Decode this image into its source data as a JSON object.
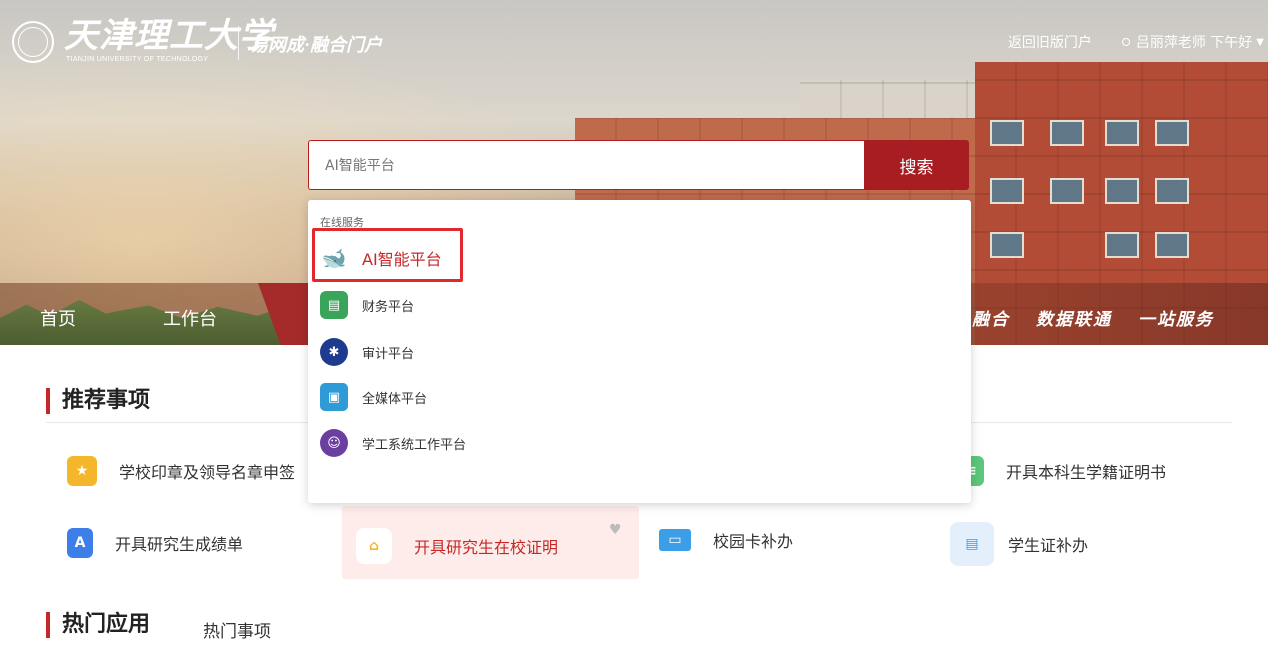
{
  "header": {
    "logo_cn": "天津理工大学",
    "logo_en": "TIANJIN UNIVERSITY OF TECHNOLOGY",
    "portal_title": "易网成·融合门户",
    "old_portal_link": "返回旧版门户",
    "greeting": "吕丽萍老师 下午好"
  },
  "search": {
    "value": "AI智能平台",
    "button": "搜索"
  },
  "dropdown": {
    "category": "在线服务",
    "items": [
      {
        "label": "AI智能平台",
        "icon": "whale-icon",
        "color": "#3a5bc7"
      },
      {
        "label": "财务平台",
        "icon": "finance-icon",
        "color": "#3aa55a"
      },
      {
        "label": "审计平台",
        "icon": "audit-icon",
        "color": "#1f3b8f"
      },
      {
        "label": "全媒体平台",
        "icon": "media-icon",
        "color": "#2e9bd6"
      },
      {
        "label": "学工系统工作平台",
        "icon": "student-work-icon",
        "color": "#6b3fa0"
      }
    ]
  },
  "nav": {
    "items": [
      "首页",
      "工作台"
    ],
    "slogan": [
      "融合",
      "数据联通",
      "一站服务"
    ]
  },
  "recommended": {
    "title": "推荐事项",
    "items": [
      {
        "label": "学校印章及领导名章申签",
        "icon": "seal-icon",
        "color": "#f5b62b"
      },
      {
        "label": "开具本科生学籍证明书",
        "icon": "certificate-icon",
        "color": "#5cc77a"
      },
      {
        "label": "开具研究生成绩单",
        "icon": "transcript-icon",
        "color": "#3d7ee8"
      },
      {
        "label": "开具研究生在校证明",
        "icon": "home-icon",
        "color": "#f5b62b"
      },
      {
        "label": "校园卡补办",
        "icon": "card-icon",
        "color": "#3d9ee8"
      },
      {
        "label": "学生证补办",
        "icon": "clipboard-icon",
        "color": "#3d9ee8"
      }
    ]
  },
  "hot": {
    "title": "热门应用",
    "secondary_tab": "热门事项"
  }
}
